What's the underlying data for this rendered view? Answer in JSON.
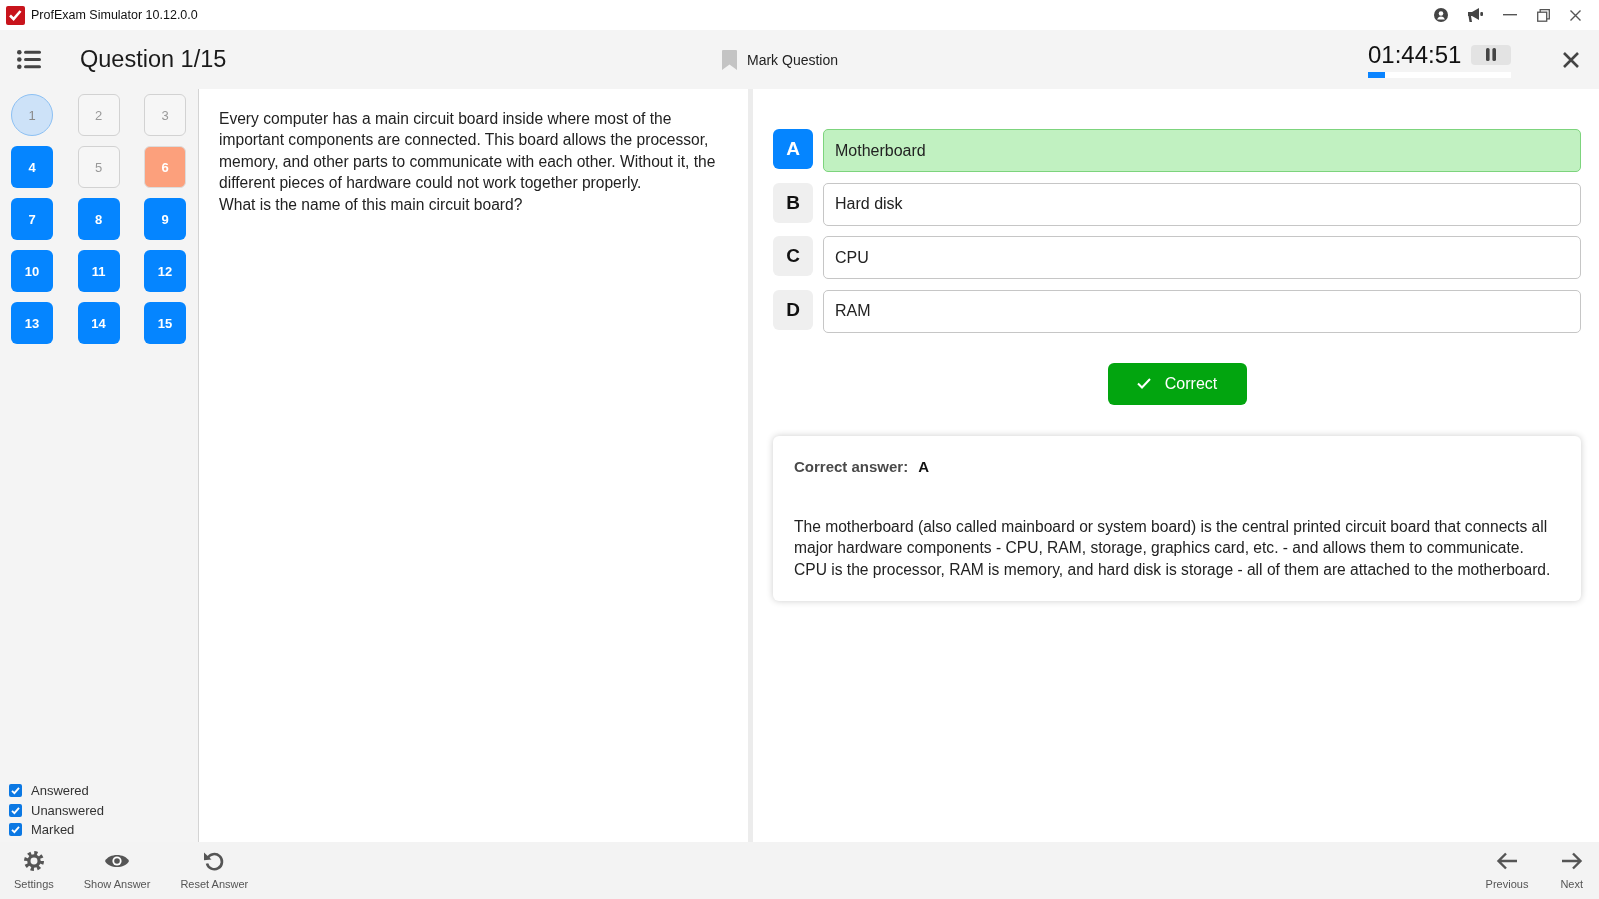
{
  "window": {
    "title": "ProfExam Simulator 10.12.0.0"
  },
  "header": {
    "title": "Question 1/15",
    "mark_question": {
      "label": "Mark Question",
      "marked": false
    },
    "timer": {
      "time": "01:44:51",
      "level": 0.12
    }
  },
  "question_nav": [
    {
      "number": "1",
      "selected": true,
      "answered": true,
      "marked": false
    },
    {
      "number": "2",
      "selected": false,
      "answered": false,
      "marked": false
    },
    {
      "number": "3",
      "selected": false,
      "answered": false,
      "marked": false
    },
    {
      "number": "4",
      "selected": false,
      "answered": true,
      "marked": false
    },
    {
      "number": "5",
      "selected": false,
      "answered": false,
      "marked": false
    },
    {
      "number": "6",
      "selected": false,
      "answered": true,
      "marked": true
    },
    {
      "number": "7",
      "selected": false,
      "answered": true,
      "marked": false
    },
    {
      "number": "8",
      "selected": false,
      "answered": true,
      "marked": false
    },
    {
      "number": "9",
      "selected": false,
      "answered": true,
      "marked": false
    },
    {
      "number": "10",
      "selected": false,
      "answered": true,
      "marked": false
    },
    {
      "number": "11",
      "selected": false,
      "answered": true,
      "marked": false
    },
    {
      "number": "12",
      "selected": false,
      "answered": true,
      "marked": false
    },
    {
      "number": "13",
      "selected": false,
      "answered": true,
      "marked": false
    },
    {
      "number": "14",
      "selected": false,
      "answered": true,
      "marked": false
    },
    {
      "number": "15",
      "selected": false,
      "answered": true,
      "marked": false
    }
  ],
  "filters": [
    {
      "label": "Answered",
      "checked": true
    },
    {
      "label": "Unanswered",
      "checked": true
    },
    {
      "label": "Marked",
      "checked": true
    }
  ],
  "question": {
    "paragraphs": [
      "Every computer has a main circuit board inside where most of the important components are connected. This board allows the processor, memory, and other parts to communicate with each other. Without it, the different pieces of hardware could not work together properly.",
      "What is the name of this main circuit board?"
    ]
  },
  "options": [
    {
      "letter": "A",
      "text": "Motherboard",
      "selected": true,
      "correct": true
    },
    {
      "letter": "B",
      "text": "Hard disk",
      "selected": false,
      "correct": false
    },
    {
      "letter": "C",
      "text": "CPU",
      "selected": false,
      "correct": false
    },
    {
      "letter": "D",
      "text": "RAM",
      "selected": false,
      "correct": false
    }
  ],
  "result": {
    "label": "Correct",
    "correct": true
  },
  "explanation": {
    "label": "Correct answer:",
    "answer": "A",
    "paragraphs": [
      "The motherboard (also called mainboard or system board) is the central printed circuit board that connects all major hardware components - CPU, RAM, storage, graphics card, etc. - and allows them to communicate.",
      "CPU is the processor, RAM is memory, and hard disk is storage - all of them are attached to the motherboard."
    ]
  },
  "toolbar": {
    "settings": {
      "label": "Settings"
    },
    "show_answer": {
      "label": "Show Answer"
    },
    "reset_answer": {
      "label": "Reset Answer"
    },
    "previous": {
      "label": "Previous"
    },
    "next": {
      "label": "Next"
    }
  }
}
